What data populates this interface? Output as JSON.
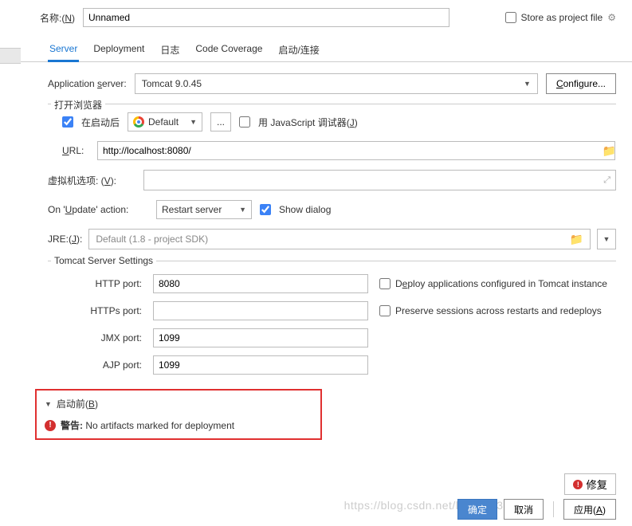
{
  "header": {
    "name_label_pre": "名称:(",
    "name_label_u": "N",
    "name_label_post": ")",
    "name_value": "Unnamed",
    "store_label": "Store as project file"
  },
  "tabs": [
    "Server",
    "Deployment",
    "日志",
    "Code Coverage",
    "启动/连接"
  ],
  "app_server": {
    "label_pre": "Application ",
    "label_u": "s",
    "label_post": "erver:",
    "value": "Tomcat 9.0.45",
    "configure_pre": "C",
    "configure_u": "o",
    "configure_post": "nfigure..."
  },
  "browser": {
    "group_title": "打开浏览器",
    "after_launch": "在启动后",
    "default": "Default",
    "js_debugger_pre": "用 JavaScript 调试器(",
    "js_debugger_u": "J",
    "js_debugger_post": ")",
    "url_label_u": "U",
    "url_label_post": "RL:",
    "url_value": "http://localhost:8080/"
  },
  "vm": {
    "label_pre": "虚拟机选项: (",
    "label_u": "V",
    "label_post": "):"
  },
  "update": {
    "label_pre": "On '",
    "label_u": "U",
    "label_post": "pdate' action:",
    "value": "Restart server",
    "show_dialog": "Show dialog"
  },
  "jre": {
    "label_pre": "JRE:(",
    "label_u": "J",
    "label_post": "):",
    "value": "Default (1.8 - project SDK)"
  },
  "tomcat": {
    "title": "Tomcat Server Settings",
    "http_label": "HTTP port:",
    "http_value": "8080",
    "https_label": "HTTPs port:",
    "https_value": "",
    "jmx_label": "JMX port:",
    "jmx_value": "1099",
    "ajp_label": "AJP port:",
    "ajp_value": "1099",
    "deploy_pre": "D",
    "deploy_u": "e",
    "deploy_post": "ploy applications configured in Tomcat instance",
    "preserve": "Preserve sessions across restarts and redeploys"
  },
  "before": {
    "title_pre": "启动前(",
    "title_u": "B",
    "title_post": ")",
    "warn_label": "警告:",
    "warn_msg": " No artifacts marked for deployment"
  },
  "buttons": {
    "fix": "修复",
    "ok": "确定",
    "cancel": "取消",
    "apply_pre": "应用(",
    "apply_u": "A",
    "apply_post": ")"
  },
  "watermark": "https://blog.csdn.net/lixin_51338267"
}
